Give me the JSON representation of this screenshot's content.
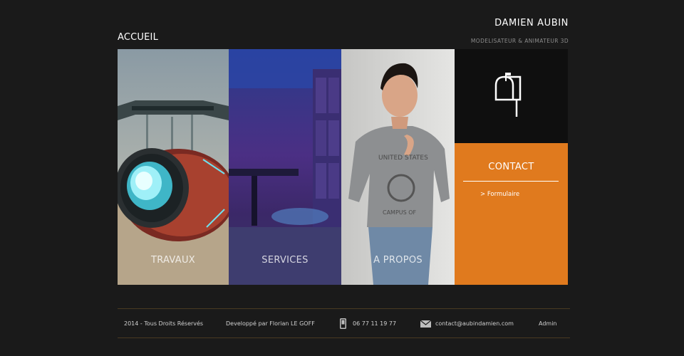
{
  "header": {
    "page_title": "ACCUEIL",
    "brand_name": "DAMIEN AUBIN",
    "brand_subtitle": "MODELISATEUR & ANIMATEUR 3D"
  },
  "panels": [
    {
      "id": "travaux",
      "label": "TRAVAUX"
    },
    {
      "id": "services",
      "label": "SERVICES"
    },
    {
      "id": "apropos",
      "label": "A PROPOS"
    },
    {
      "id": "contact",
      "label": "CONTACT",
      "link": "> Formulaire"
    }
  ],
  "footer": {
    "copyright": "2014 - Tous Droits Réservés",
    "developer": "Developpé par Florian LE GOFF",
    "phone": "06 77 11 19 77",
    "email": "contact@aubindamien.com",
    "admin": "Admin"
  },
  "icons": {
    "phone": "phone-icon",
    "email": "envelope-icon",
    "contact": "mailbox-icon"
  },
  "colors": {
    "background": "#1a1a1a",
    "accent_orange": "#e07a1e",
    "footer_rule": "#4a3a22"
  }
}
